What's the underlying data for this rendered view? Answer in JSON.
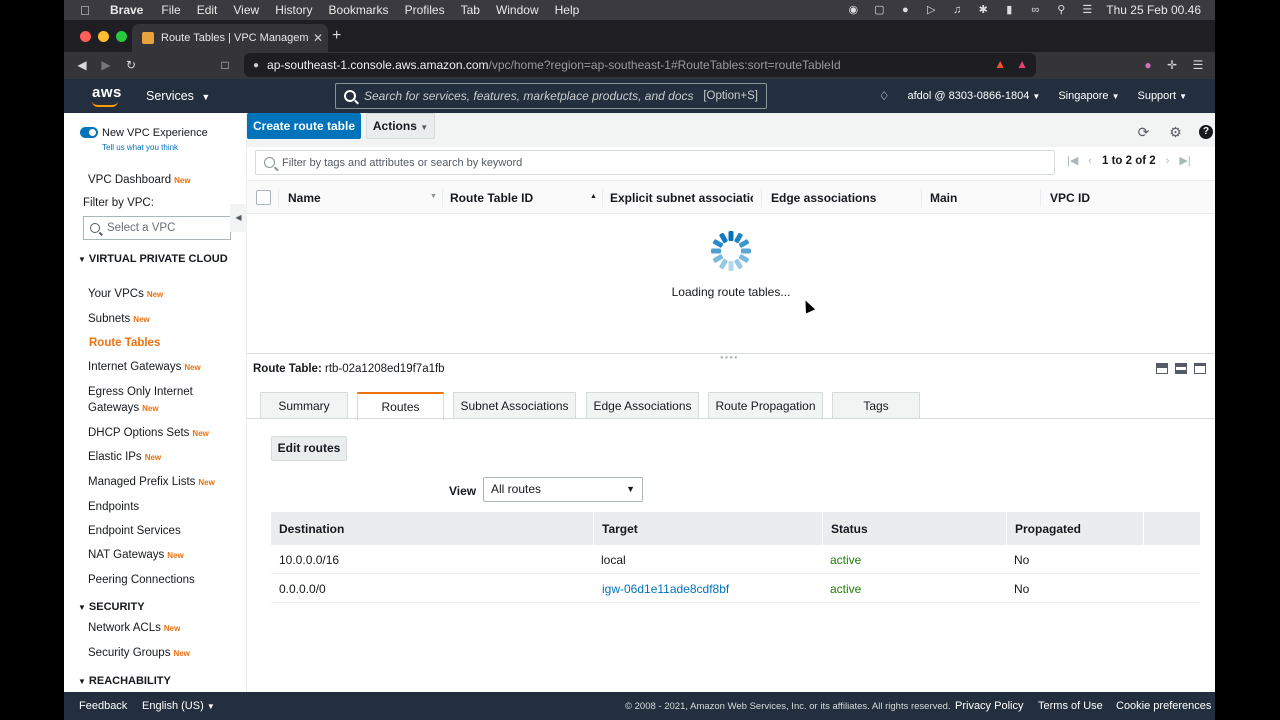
{
  "menubar": {
    "app": "Brave",
    "items": [
      "File",
      "Edit",
      "View",
      "History",
      "Bookmarks",
      "Profiles",
      "Tab",
      "Window",
      "Help"
    ],
    "clock": "Thu 25 Feb  00.46"
  },
  "browser": {
    "tab_title": "Route Tables | VPC Management",
    "url_host": "ap-southeast-1.console.aws.amazon.com",
    "url_path": "/vpc/home?region=ap-southeast-1#RouteTables:sort=routeTableId"
  },
  "awsnav": {
    "logo": "aws",
    "services": "Services",
    "search_placeholder": "Search for services, features, marketplace products, and docs",
    "search_shortcut": "[Option+S]",
    "account": "afdol @ 8303-0866-1804",
    "region": "Singapore",
    "support": "Support"
  },
  "sidebar": {
    "new_experience": "New VPC Experience",
    "tell_us": "Tell us what you think",
    "dashboard": "VPC Dashboard",
    "filter_label": "Filter by VPC:",
    "vpc_placeholder": "Select a VPC",
    "new_badge": "New",
    "sections": {
      "vpc": "VIRTUAL PRIVATE CLOUD",
      "security": "SECURITY",
      "reachability": "REACHABILITY"
    },
    "items": {
      "your_vpcs": "Your VPCs",
      "subnets": "Subnets",
      "route_tables": "Route Tables",
      "internet_gateways": "Internet Gateways",
      "egress_1": "Egress Only Internet",
      "egress_2": "Gateways",
      "dhcp": "DHCP Options Sets",
      "elastic_ips": "Elastic IPs",
      "prefix_lists": "Managed Prefix Lists",
      "endpoints": "Endpoints",
      "endpoint_services": "Endpoint Services",
      "nat": "NAT Gateways",
      "peering": "Peering Connections",
      "nacls": "Network ACLs",
      "security_groups": "Security Groups"
    }
  },
  "toolbar": {
    "create": "Create route table",
    "actions": "Actions"
  },
  "list": {
    "filter_placeholder": "Filter by tags and attributes or search by keyword",
    "pagination": "1 to 2 of 2",
    "columns": [
      "Name",
      "Route Table ID",
      "Explicit subnet association",
      "Edge associations",
      "Main",
      "VPC ID"
    ],
    "loading": "Loading route tables..."
  },
  "detail": {
    "label": "Route Table:",
    "id": "rtb-02a1208ed19f7a1fb",
    "tabs": [
      "Summary",
      "Routes",
      "Subnet Associations",
      "Edge Associations",
      "Route Propagation",
      "Tags"
    ],
    "active_tab": "Routes",
    "edit_routes": "Edit routes",
    "view_label": "View",
    "view_value": "All routes",
    "columns": [
      "Destination",
      "Target",
      "Status",
      "Propagated"
    ],
    "routes": [
      {
        "destination": "10.0.0.0/16",
        "target": "local",
        "status": "active",
        "propagated": "No"
      },
      {
        "destination": "0.0.0.0/0",
        "target": "igw-06d1e11ade8cdf8bf",
        "status": "active",
        "propagated": "No"
      }
    ]
  },
  "footer": {
    "feedback": "Feedback",
    "language": "English (US)",
    "copyright": "© 2008 - 2021, Amazon Web Services, Inc. or its affiliates. All rights reserved.",
    "privacy": "Privacy Policy",
    "terms": "Terms of Use",
    "cookies": "Cookie preferences"
  },
  "colors": {
    "aws_nav": "#232f3e",
    "primary": "#0073bb",
    "accent": "#ec7211",
    "status_active": "#1d8102"
  }
}
